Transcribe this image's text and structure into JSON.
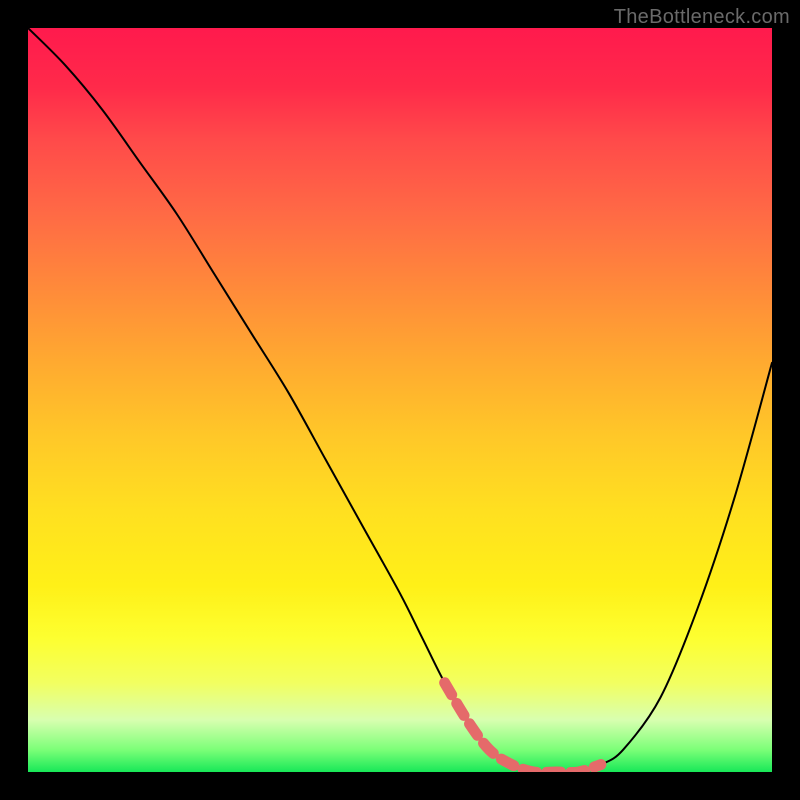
{
  "watermark": "TheBottleneck.com",
  "chart_data": {
    "type": "line",
    "title": "",
    "xlabel": "",
    "ylabel": "",
    "xlim": [
      0,
      100
    ],
    "ylim": [
      0,
      100
    ],
    "series": [
      {
        "name": "bottleneck-curve",
        "x": [
          0,
          5,
          10,
          15,
          20,
          25,
          30,
          35,
          40,
          45,
          50,
          53,
          56,
          59,
          62,
          65,
          68,
          71,
          74,
          77,
          80,
          85,
          90,
          95,
          100
        ],
        "y": [
          100,
          95,
          89,
          82,
          75,
          67,
          59,
          51,
          42,
          33,
          24,
          18,
          12,
          7,
          3,
          1,
          0,
          0,
          0,
          1,
          3,
          10,
          22,
          37,
          55
        ]
      },
      {
        "name": "highlight-minimum",
        "x": [
          56,
          59,
          62,
          65,
          68,
          71,
          74,
          77
        ],
        "y": [
          12,
          7,
          3,
          1,
          0,
          0,
          0,
          1
        ]
      }
    ],
    "colors": {
      "curve": "#000000",
      "highlight": "#e56a6a",
      "gradient_top": "#ff1a4d",
      "gradient_mid": "#ffe020",
      "gradient_bottom": "#18e858"
    }
  }
}
